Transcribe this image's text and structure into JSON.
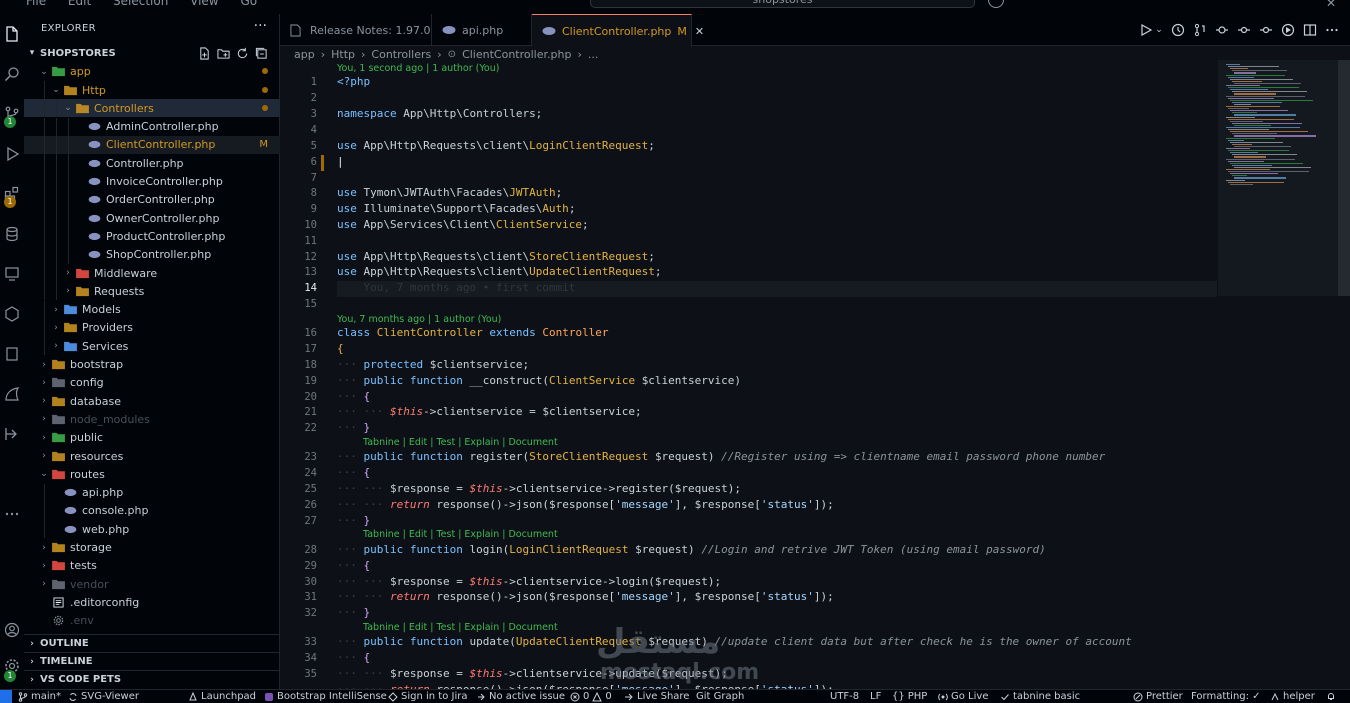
{
  "titlebar": {
    "menu": [
      "File",
      "Edit",
      "Selection",
      "View",
      "Go"
    ],
    "command_center": "shopstores"
  },
  "activity": {
    "badge_scm": "1",
    "badge_ext": "1"
  },
  "sidebar": {
    "title": "EXPLORER",
    "workspace": "SHOPSTORES",
    "tree": [
      {
        "label": "app",
        "depth": 0,
        "type": "folder",
        "open": true,
        "status": "dot",
        "color": "green"
      },
      {
        "label": "Http",
        "depth": 1,
        "type": "folder",
        "open": true,
        "status": "dot",
        "color": "yellow"
      },
      {
        "label": "Controllers",
        "depth": 2,
        "type": "folder",
        "open": true,
        "status": "dot",
        "color": "yellow",
        "highlight": true
      },
      {
        "label": "AdminController.php",
        "depth": 3,
        "type": "php"
      },
      {
        "label": "ClientController.php",
        "depth": 3,
        "type": "php",
        "selected": true,
        "modified": "M"
      },
      {
        "label": "Controller.php",
        "depth": 3,
        "type": "php"
      },
      {
        "label": "InvoiceController.php",
        "depth": 3,
        "type": "php"
      },
      {
        "label": "OrderController.php",
        "depth": 3,
        "type": "php"
      },
      {
        "label": "OwnerController.php",
        "depth": 3,
        "type": "php"
      },
      {
        "label": "ProductController.php",
        "depth": 3,
        "type": "php"
      },
      {
        "label": "ShopController.php",
        "depth": 3,
        "type": "php"
      },
      {
        "label": "Middleware",
        "depth": 2,
        "type": "folder",
        "color": "red"
      },
      {
        "label": "Requests",
        "depth": 2,
        "type": "folder",
        "color": "yellow"
      },
      {
        "label": "Models",
        "depth": 1,
        "type": "folder",
        "color": "blue"
      },
      {
        "label": "Providers",
        "depth": 1,
        "type": "folder",
        "color": "yellow"
      },
      {
        "label": "Services",
        "depth": 1,
        "type": "folder",
        "color": "blue"
      },
      {
        "label": "bootstrap",
        "depth": 0,
        "type": "folder",
        "color": "yellow"
      },
      {
        "label": "config",
        "depth": 0,
        "type": "folder",
        "color": "grey"
      },
      {
        "label": "database",
        "depth": 0,
        "type": "folder",
        "color": "yellow"
      },
      {
        "label": "node_modules",
        "depth": 0,
        "type": "folder",
        "color": "grey",
        "dim": true
      },
      {
        "label": "public",
        "depth": 0,
        "type": "folder",
        "color": "green"
      },
      {
        "label": "resources",
        "depth": 0,
        "type": "folder",
        "color": "yellow"
      },
      {
        "label": "routes",
        "depth": 0,
        "type": "folder",
        "open": true,
        "color": "red"
      },
      {
        "label": "api.php",
        "depth": 1,
        "type": "php"
      },
      {
        "label": "console.php",
        "depth": 1,
        "type": "php"
      },
      {
        "label": "web.php",
        "depth": 1,
        "type": "php"
      },
      {
        "label": "storage",
        "depth": 0,
        "type": "folder",
        "color": "yellow"
      },
      {
        "label": "tests",
        "depth": 0,
        "type": "folder",
        "color": "red"
      },
      {
        "label": "vendor",
        "depth": 0,
        "type": "folder",
        "color": "grey",
        "dim": true
      },
      {
        "label": ".editorconfig",
        "depth": 0,
        "type": "editorconfig"
      },
      {
        "label": ".env",
        "depth": 0,
        "type": "env",
        "dim": true
      }
    ],
    "sections": [
      "OUTLINE",
      "TIMELINE",
      "VS CODE PETS"
    ]
  },
  "tabs": [
    {
      "label": "Release Notes: 1.97.0",
      "active": false
    },
    {
      "label": "api.php",
      "active": false
    },
    {
      "label": "ClientController.php",
      "active": true,
      "modified": "M",
      "close": "✕"
    }
  ],
  "breadcrumb": [
    "app",
    "Http",
    "Controllers",
    "ClientController.php",
    "..."
  ],
  "editor": {
    "lenses": {
      "blame_top": "You, 1 second ago | 1 author (You)",
      "blame_class": "You, 7 months ago | 1 author (You)",
      "tabnine": "Tabnine | Edit | Test | Explain | Document",
      "inline_blame": "You, 7 months ago • first commit"
    },
    "line_numbers": [
      "1",
      "2",
      "3",
      "4",
      "5",
      "6",
      "7",
      "8",
      "9",
      "10",
      "11",
      "12",
      "13",
      "14",
      "15",
      "16",
      "17",
      "18",
      "19",
      "20",
      "21",
      "22",
      "23",
      "24",
      "25",
      "26",
      "27",
      "28",
      "29",
      "30",
      "31",
      "32",
      "33",
      "34",
      "35"
    ],
    "current_line": "14"
  },
  "statusbar": {
    "branch": "main*",
    "svg_viewer": "SVG-Viewer",
    "launchpad": "Launchpad",
    "bootstrap": "Bootstrap IntelliSense",
    "jira": "Sign in to Jira",
    "issue": "No active issue",
    "problems": "0",
    "warnings": "0",
    "live_share": "Live Share",
    "git_graph": "Git Graph",
    "encoding": "UTF-8",
    "eol": "LF",
    "language": "PHP",
    "go_live": "Go Live",
    "tabnine": "tabnine basic",
    "prettier": "Prettier",
    "formatting": "Formatting: ✓",
    "helper": "helper"
  },
  "watermark": {
    "arabic": "مستقل",
    "latin": "mostaql.com"
  },
  "colors": {
    "accent": "#d29922",
    "lens": "#3fb950",
    "tab_border": "#f78166"
  }
}
